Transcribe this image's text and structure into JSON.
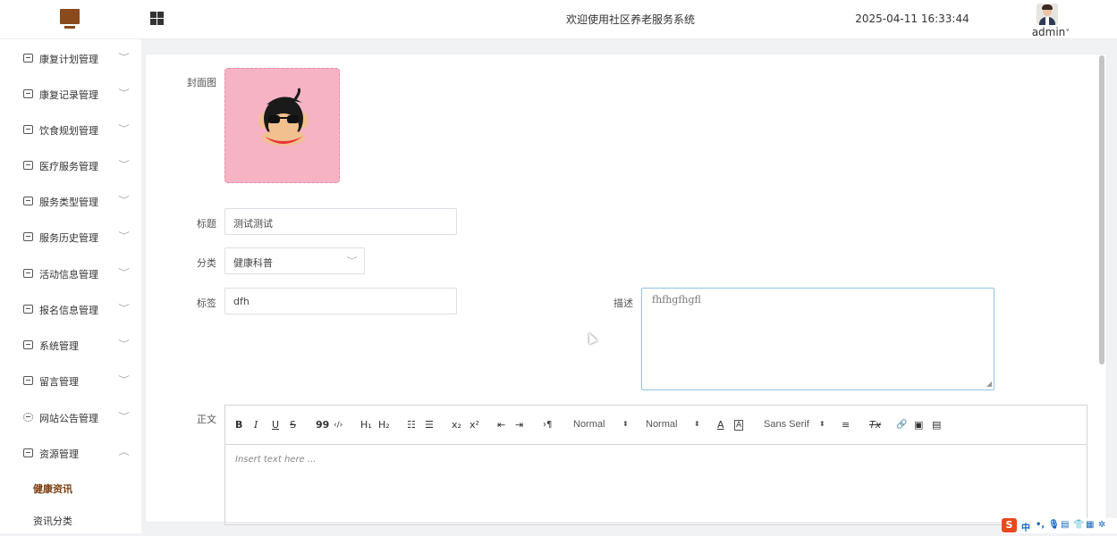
{
  "header": {
    "title": "欢迎使用社区养老服务系统",
    "datetime": "2025-04-11 16:33:44",
    "username": "admin",
    "username_chevron": "˅"
  },
  "icons": {
    "logo": "monitor-icon",
    "menu_toggle": "grid-icon",
    "avatar": "avatar-icon"
  },
  "sidebar": {
    "items": [
      {
        "label": "康复计划管理",
        "chevron": "﹀"
      },
      {
        "label": "康复记录管理",
        "chevron": "﹀"
      },
      {
        "label": "饮食规划管理",
        "chevron": "﹀"
      },
      {
        "label": "医疗服务管理",
        "chevron": "﹀"
      },
      {
        "label": "服务类型管理",
        "chevron": "﹀"
      },
      {
        "label": "服务历史管理",
        "chevron": "﹀"
      },
      {
        "label": "活动信息管理",
        "chevron": "﹀"
      },
      {
        "label": "报名信息管理",
        "chevron": "﹀"
      },
      {
        "label": "系统管理",
        "chevron": "﹀"
      },
      {
        "label": "留言管理",
        "chevron": "﹀"
      },
      {
        "label": "网站公告管理",
        "chevron": "﹀"
      },
      {
        "label": "资源管理",
        "chevron": "︿"
      }
    ],
    "submenu": [
      {
        "label": "健康资讯",
        "active": true
      },
      {
        "label": "资讯分类",
        "active": false
      }
    ]
  },
  "form": {
    "cover_label": "封面图",
    "title_label": "标题",
    "title_value": "测试测试",
    "category_label": "分类",
    "category_value": "健康科普",
    "tags_label": "标签",
    "tags_value": "dfh",
    "desc_label": "描述",
    "desc_value": "fhfhgfhgfl",
    "body_label": "正文"
  },
  "editor": {
    "toolbar": {
      "bold": "B",
      "italic": "I",
      "underline": "U",
      "strike": "S",
      "blockquote": "99",
      "code": "‹/›",
      "h1": "H₁",
      "h2": "H₂",
      "ordered_list": "☷",
      "bullet_list": "☰",
      "subscript": "x₂",
      "superscript": "x²",
      "indent_less": "⇤",
      "indent_more": "⇥",
      "direction": "›¶",
      "size_select": "Normal",
      "header_select": "Normal",
      "font_color": "A",
      "background": "A",
      "font_select": "Sans Serif",
      "align": "≡",
      "clean": "Tx",
      "link": "🔗",
      "image": "▣",
      "video": "▤",
      "select_arrow": "⬍"
    },
    "placeholder": "Insert text here ..."
  },
  "tray": {
    "ime_logo": "S",
    "ime_lang": "中",
    "items": [
      "•,",
      "🎙",
      "▤",
      "👕",
      "▦",
      "✲"
    ]
  },
  "colors": {
    "brand": "#8a4a1c",
    "active_submenu": "#7a3e10",
    "cover_bg": "#f6b3c4",
    "textarea_focus": "#8ec5e6"
  }
}
